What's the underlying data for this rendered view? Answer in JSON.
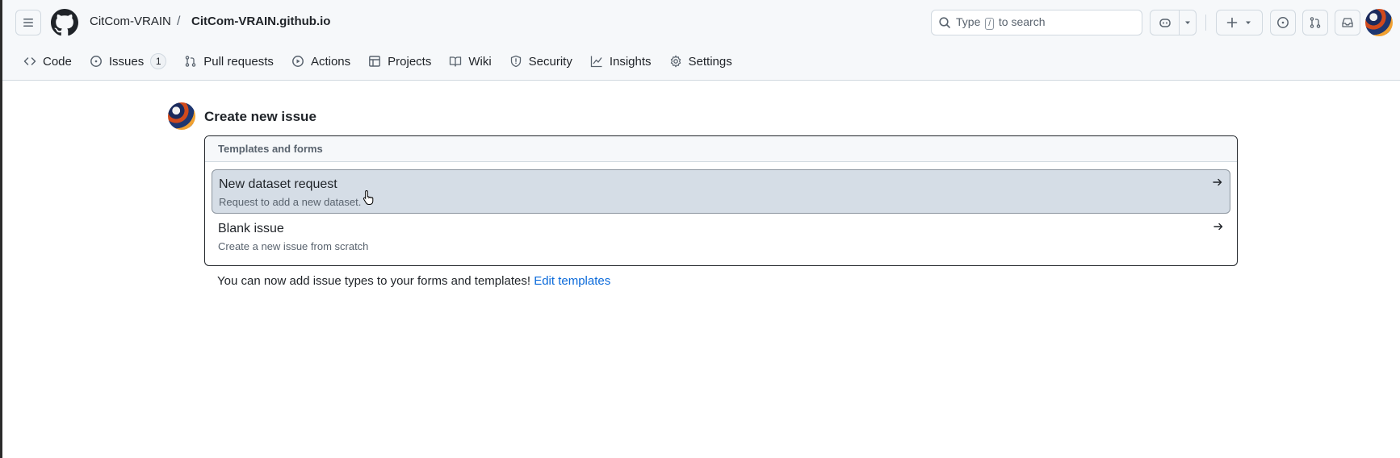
{
  "header": {
    "owner": "CitCom-VRAIN",
    "separator": "/",
    "repo": "CitCom-VRAIN.github.io",
    "search": {
      "before": "Type",
      "key": "/",
      "after": "to search"
    }
  },
  "repo_nav": [
    {
      "label": "Code",
      "icon": "code-icon"
    },
    {
      "label": "Issues",
      "icon": "issue-opened-icon",
      "count": "1"
    },
    {
      "label": "Pull requests",
      "icon": "git-pull-request-icon"
    },
    {
      "label": "Actions",
      "icon": "play-icon"
    },
    {
      "label": "Projects",
      "icon": "table-icon"
    },
    {
      "label": "Wiki",
      "icon": "book-icon"
    },
    {
      "label": "Security",
      "icon": "shield-icon"
    },
    {
      "label": "Insights",
      "icon": "graph-icon"
    },
    {
      "label": "Settings",
      "icon": "gear-icon"
    }
  ],
  "main": {
    "title": "Create new issue",
    "section_header": "Templates and forms",
    "options": [
      {
        "title": "New dataset request",
        "description": "Request to add a new dataset."
      },
      {
        "title": "Blank issue",
        "description": "Create a new issue from scratch"
      }
    ],
    "footer_text": "You can now add issue types to your forms and templates!",
    "footer_link": "Edit templates"
  },
  "colors": {
    "accent": "#0969da",
    "hover_row": "#d5dde6",
    "header_bg": "#f6f8fa"
  }
}
